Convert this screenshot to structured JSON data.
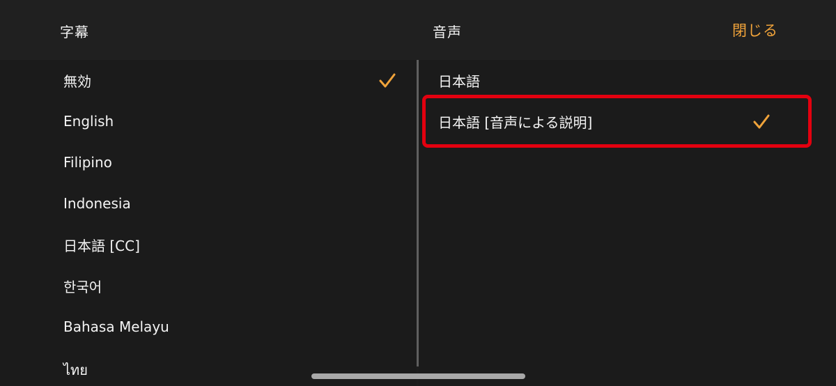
{
  "header": {
    "subtitles_title": "字幕",
    "audio_title": "音声",
    "close_label": "閉じる"
  },
  "subtitles": {
    "items": [
      {
        "label": "無効",
        "selected": true
      },
      {
        "label": "English",
        "selected": false
      },
      {
        "label": "Filipino",
        "selected": false
      },
      {
        "label": "Indonesia",
        "selected": false
      },
      {
        "label": "日本語 [CC]",
        "selected": false
      },
      {
        "label": "한국어",
        "selected": false
      },
      {
        "label": "Bahasa Melayu",
        "selected": false
      },
      {
        "label": "ไทย",
        "selected": false
      }
    ]
  },
  "audio": {
    "items": [
      {
        "label": "日本語",
        "selected": false
      },
      {
        "label": "日本語 [音声による説明]",
        "selected": true
      }
    ]
  },
  "colors": {
    "accent": "#f0a33a",
    "highlight": "#e3000f",
    "background": "#1b1b1b"
  }
}
